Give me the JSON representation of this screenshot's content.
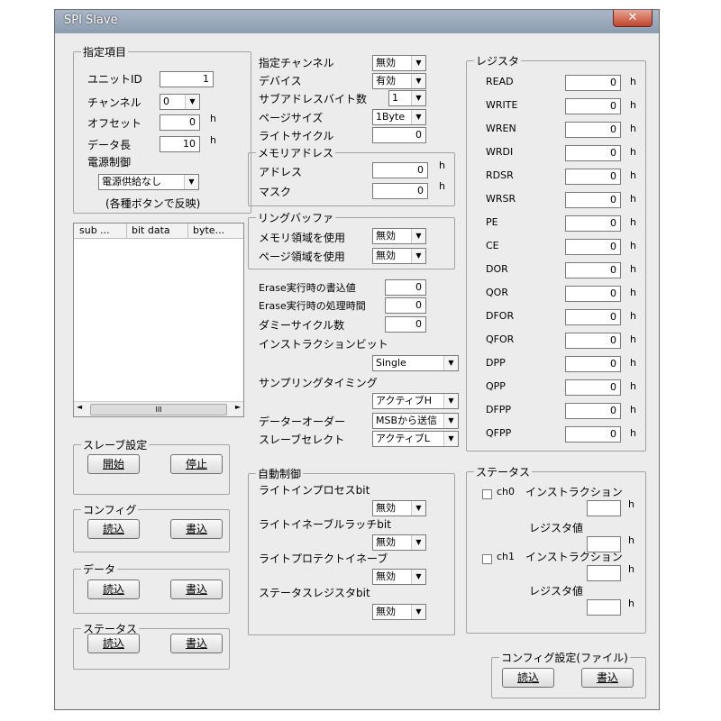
{
  "window": {
    "title": "SPI Slave",
    "close": "✕"
  },
  "spec": {
    "legend": "指定項目",
    "unit_id_label": "ユニットID",
    "unit_id_value": "1",
    "channel_label": "チャンネル",
    "channel_value": "0",
    "offset_label": "オフセット",
    "offset_value": "0",
    "data_len_label": "データ長",
    "data_len_value": "10",
    "power_label": "電源制御",
    "power_value": "電源供給なし",
    "note": "(各種ボタンで反映)"
  },
  "list": {
    "columns": [
      "sub ...",
      "bit data",
      "byte..."
    ],
    "scroll_mid": "III"
  },
  "middle": {
    "channel_label": "指定チャンネル",
    "channel_value": "無効",
    "device_label": "デバイス",
    "device_value": "有効",
    "subaddr_label": "サブアドレスバイト数",
    "subaddr_value": "1",
    "pagesize_label": "ページサイズ",
    "pagesize_value": "1Byte",
    "writecycle_label": "ライトサイクル",
    "writecycle_value": "0",
    "memaddr": {
      "legend": "メモリアドレス",
      "address_label": "アドレス",
      "address_value": "0",
      "mask_label": "マスク",
      "mask_value": "0"
    },
    "ring": {
      "legend": "リングバッファ",
      "mem_label": "メモリ領域を使用",
      "mem_value": "無効",
      "page_label": "ページ領域を使用",
      "page_value": "無効"
    },
    "erase_write_label": "Erase実行時の書込値",
    "erase_write_value": "0",
    "erase_time_label": "Erase実行時の処理時間",
    "erase_time_value": "0",
    "dummy_label": "ダミーサイクル数",
    "dummy_value": "0",
    "instr_bit_label": "インストラクションビット",
    "instr_bit_value": "Single",
    "sampling_label": "サンプリングタイミング",
    "sampling_value": "アクティブH",
    "order_label": "データーオーダー",
    "order_value": "MSBから送信",
    "slave_select_label": "スレーブセレクト",
    "slave_select_value": "アクティブL"
  },
  "auto": {
    "legend": "自動制御",
    "wip_label": "ライトインプロセスbit",
    "wip_value": "無効",
    "wel_label": "ライトイネーブルラッチbit",
    "wel_value": "無効",
    "wp_label": "ライトプロテクトイネーブ",
    "wp_value": "無効",
    "sr_label": "ステータスレジスタbit",
    "sr_value": "無効"
  },
  "registers": {
    "legend": "レジスタ",
    "unit": "h",
    "items": [
      {
        "name": "READ",
        "value": "0"
      },
      {
        "name": "WRITE",
        "value": "0"
      },
      {
        "name": "WREN",
        "value": "0"
      },
      {
        "name": "WRDI",
        "value": "0"
      },
      {
        "name": "RDSR",
        "value": "0"
      },
      {
        "name": "WRSR",
        "value": "0"
      },
      {
        "name": "PE",
        "value": "0"
      },
      {
        "name": "CE",
        "value": "0"
      },
      {
        "name": "DOR",
        "value": "0"
      },
      {
        "name": "QOR",
        "value": "0"
      },
      {
        "name": "DFOR",
        "value": "0"
      },
      {
        "name": "QFOR",
        "value": "0"
      },
      {
        "name": "DPP",
        "value": "0"
      },
      {
        "name": "QPP",
        "value": "0"
      },
      {
        "name": "DFPP",
        "value": "0"
      },
      {
        "name": "QFPP",
        "value": "0"
      }
    ]
  },
  "status_right": {
    "legend": "ステータス",
    "ch0": "ch0",
    "ch1": "ch1",
    "instr_label": "インストラクション",
    "reg_label": "レジスタ値",
    "unit": "h"
  },
  "slave": {
    "legend": "スレーブ設定",
    "start": "開始",
    "stop": "停止"
  },
  "config": {
    "legend": "コンフィグ",
    "read": "読込",
    "write": "書込"
  },
  "data_grp": {
    "legend": "データ",
    "read": "読込",
    "write": "書込"
  },
  "status_left": {
    "legend": "ステータス",
    "read": "読込",
    "write": "書込"
  },
  "config_file": {
    "legend": "コンフィグ設定(ファイル)",
    "read": "読込",
    "write": "書込"
  },
  "unit_h": "h"
}
